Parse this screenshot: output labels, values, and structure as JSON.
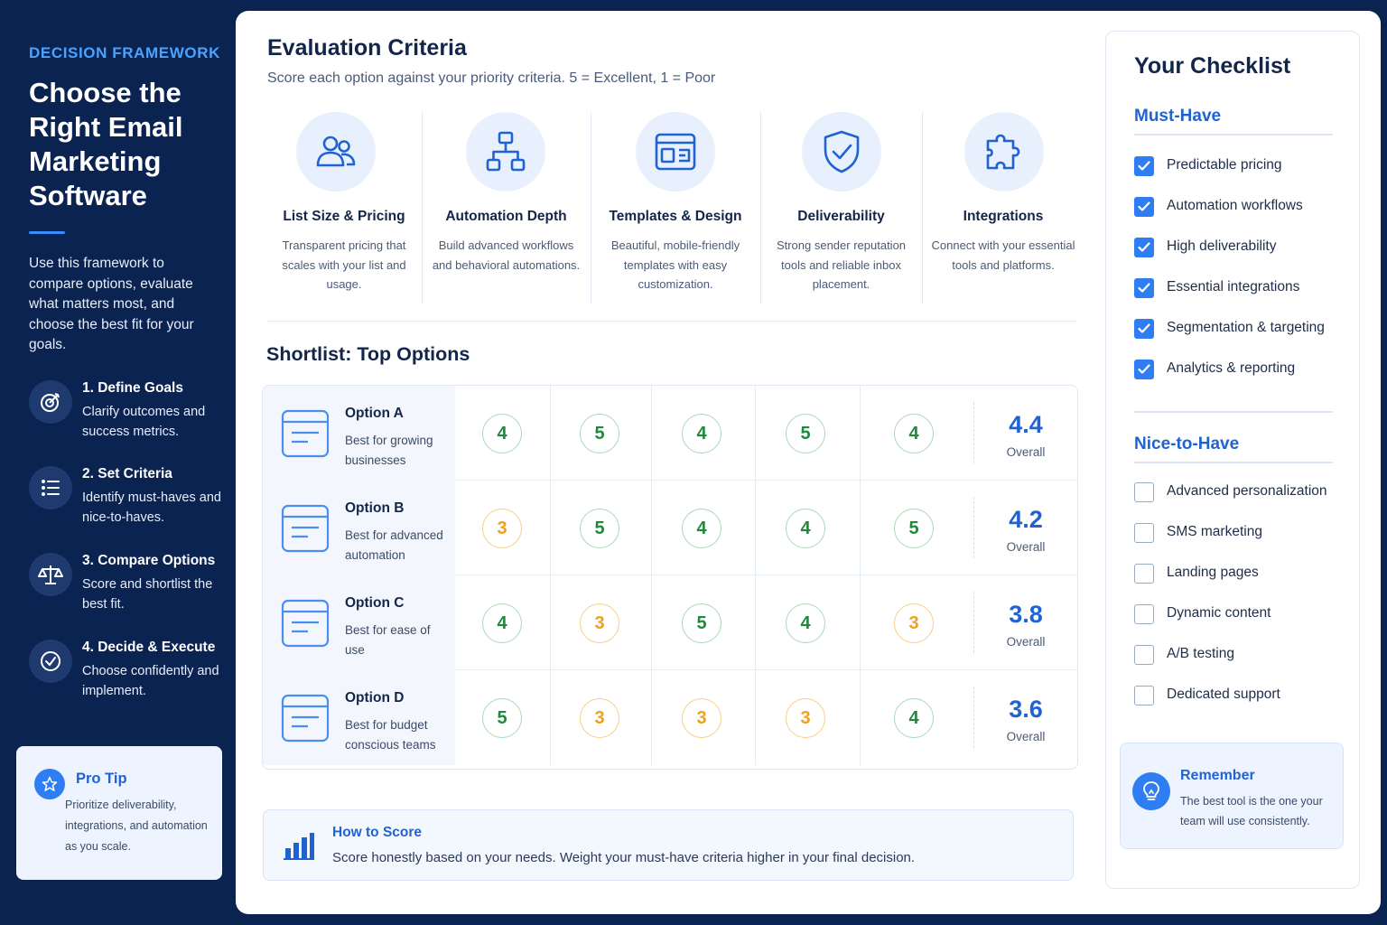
{
  "sidebar": {
    "kicker": "DECISION FRAMEWORK",
    "title": "Choose the Right Email Marketing Software",
    "description": "Use this framework to compare options, evaluate what matters most, and choose the best fit for your goals.",
    "steps": [
      {
        "title": "1. Define Goals",
        "desc": "Clarify outcomes and success metrics.",
        "icon": "target-icon"
      },
      {
        "title": "2. Set Criteria",
        "desc": "Identify must-haves and nice-to-haves.",
        "icon": "list-icon"
      },
      {
        "title": "3. Compare Options",
        "desc": "Score and shortlist the best fit.",
        "icon": "scale-icon"
      },
      {
        "title": "4. Decide & Execute",
        "desc": "Choose confidently and implement.",
        "icon": "check-circle-icon"
      }
    ],
    "pro_tip": {
      "title": "Pro Tip",
      "text": "Prioritize deliverability, integrations, and automation as you scale."
    }
  },
  "evaluation": {
    "title": "Evaluation Criteria",
    "subtitle": "Score each option against your priority criteria. 5 = Excellent, 1 = Poor",
    "criteria": [
      {
        "title": "List Size & Pricing",
        "desc": "Transparent pricing that scales with your list and usage.",
        "icon": "users-icon"
      },
      {
        "title": "Automation Depth",
        "desc": "Build advanced workflows and behavioral automations.",
        "icon": "workflow-icon"
      },
      {
        "title": "Templates & Design",
        "desc": "Beautiful, mobile-friendly templates with easy customization.",
        "icon": "layout-icon"
      },
      {
        "title": "Deliverability",
        "desc": "Strong sender reputation tools and reliable inbox placement.",
        "icon": "shield-check-icon"
      },
      {
        "title": "Integrations",
        "desc": "Connect with your essential tools and platforms.",
        "icon": "puzzle-icon"
      }
    ]
  },
  "shortlist": {
    "title": "Shortlist: Top Options",
    "overall_label": "Overall",
    "options": [
      {
        "name": "Option A",
        "desc": "Best for growing businesses",
        "scores": [
          4,
          5,
          4,
          5,
          4
        ],
        "overall": "4.4"
      },
      {
        "name": "Option B",
        "desc": "Best for advanced automation",
        "scores": [
          3,
          5,
          4,
          4,
          5
        ],
        "overall": "4.2"
      },
      {
        "name": "Option C",
        "desc": "Best for ease of use",
        "scores": [
          4,
          3,
          5,
          4,
          3
        ],
        "overall": "3.8"
      },
      {
        "name": "Option D",
        "desc": "Best for budget conscious teams",
        "scores": [
          5,
          3,
          3,
          3,
          4
        ],
        "overall": "3.6"
      }
    ]
  },
  "how_to_score": {
    "title": "How to Score",
    "text": "Score honestly based on your needs. Weight your must-have criteria higher in your final decision."
  },
  "checklist": {
    "title": "Your Checklist",
    "must_have_title": "Must-Have",
    "must_have": [
      "Predictable pricing",
      "Automation workflows",
      "High deliverability",
      "Essential integrations",
      "Segmentation & targeting",
      "Analytics & reporting"
    ],
    "nice_to_have_title": "Nice-to-Have",
    "nice_to_have": [
      "Advanced personalization",
      "SMS marketing",
      "Landing pages",
      "Dynamic content",
      "A/B testing",
      "Dedicated support"
    ],
    "remember": {
      "title": "Remember",
      "text": "The best tool is the one your team will use consistently."
    }
  },
  "colors": {
    "navy": "#0b2350",
    "accent": "#2f7df2",
    "score_high": "#1e8a3c",
    "score_mid": "#f0a020"
  }
}
